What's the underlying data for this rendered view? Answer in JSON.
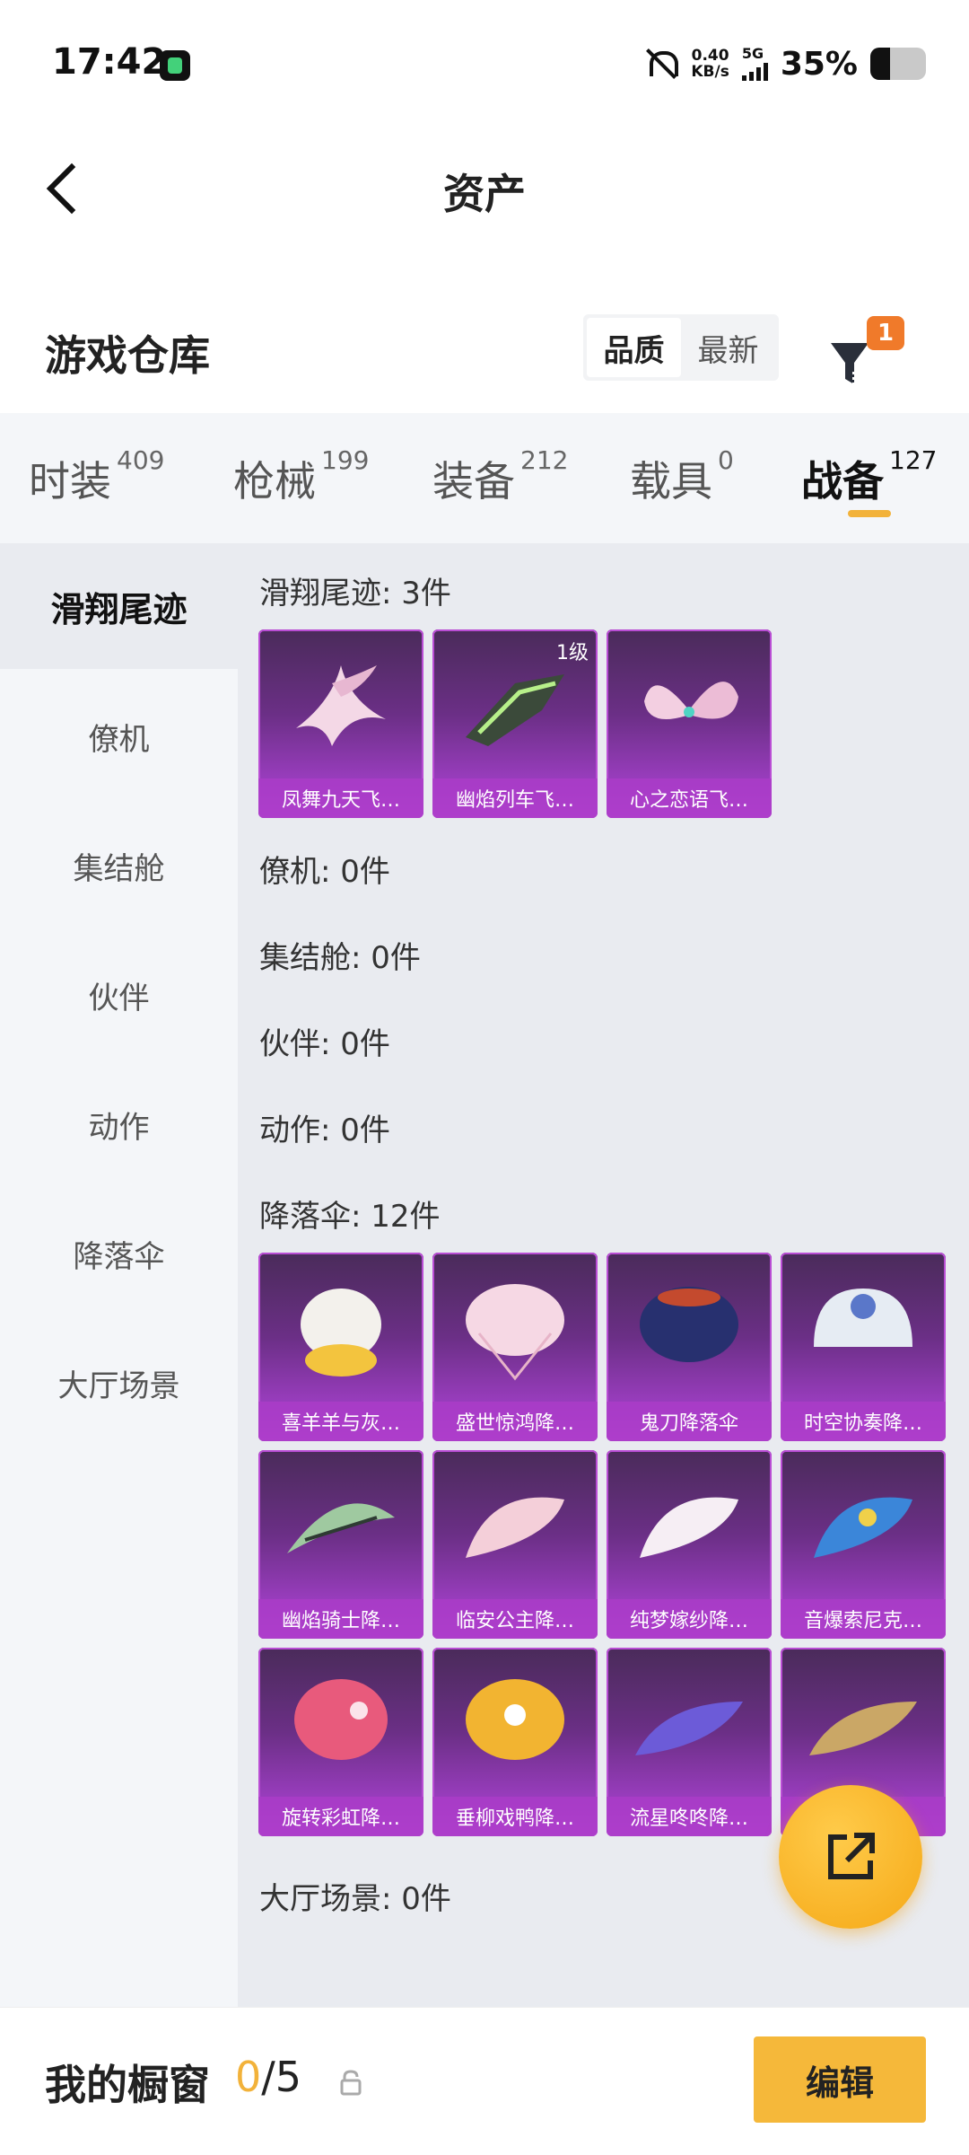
{
  "status_bar": {
    "time": "17:42",
    "net_speed_value": "0.40",
    "net_speed_unit": "KB/s",
    "network": "5G",
    "battery_percent": "35%",
    "battery_level": 0.35
  },
  "header": {
    "title": "资产"
  },
  "warehouse": {
    "title": "游戏仓库",
    "sort_options": [
      "品质",
      "最新"
    ],
    "filter_badge": "1"
  },
  "tabs": [
    {
      "label": "时装",
      "count": "409"
    },
    {
      "label": "枪械",
      "count": "199"
    },
    {
      "label": "装备",
      "count": "212"
    },
    {
      "label": "载具",
      "count": "0"
    },
    {
      "label": "战备",
      "count": "127"
    }
  ],
  "sidebar": {
    "items": [
      "滑翔尾迹",
      "僚机",
      "集结舱",
      "伙伴",
      "动作",
      "降落伞",
      "大厅场景"
    ]
  },
  "sections": {
    "glide_title": "滑翔尾迹: 3件",
    "glide_items": [
      {
        "name": "凤舞九天飞…",
        "level": ""
      },
      {
        "name": "幽焰列车飞…",
        "level": "1级"
      },
      {
        "name": "心之恋语飞…",
        "level": ""
      }
    ],
    "wingman_title": "僚机: 0件",
    "assembly_title": "集结舱: 0件",
    "partner_title": "伙伴: 0件",
    "action_title": "动作: 0件",
    "parachute_title": "降落伞: 12件",
    "parachute_items": [
      "喜羊羊与灰…",
      "盛世惊鸿降…",
      "鬼刀降落伞",
      "时空协奏降…",
      "幽焰骑士降…",
      "临安公主降…",
      "纯梦嫁纱降…",
      "音爆索尼克…",
      "旋转彩虹降…",
      "垂柳戏鸭降…",
      "流星咚咚降…",
      ""
    ],
    "lobby_title": "大厅场景: 0件"
  },
  "bottom": {
    "showcase_label": "我的橱窗",
    "showcase_current": "0",
    "showcase_total": "/5",
    "edit_label": "编辑"
  }
}
